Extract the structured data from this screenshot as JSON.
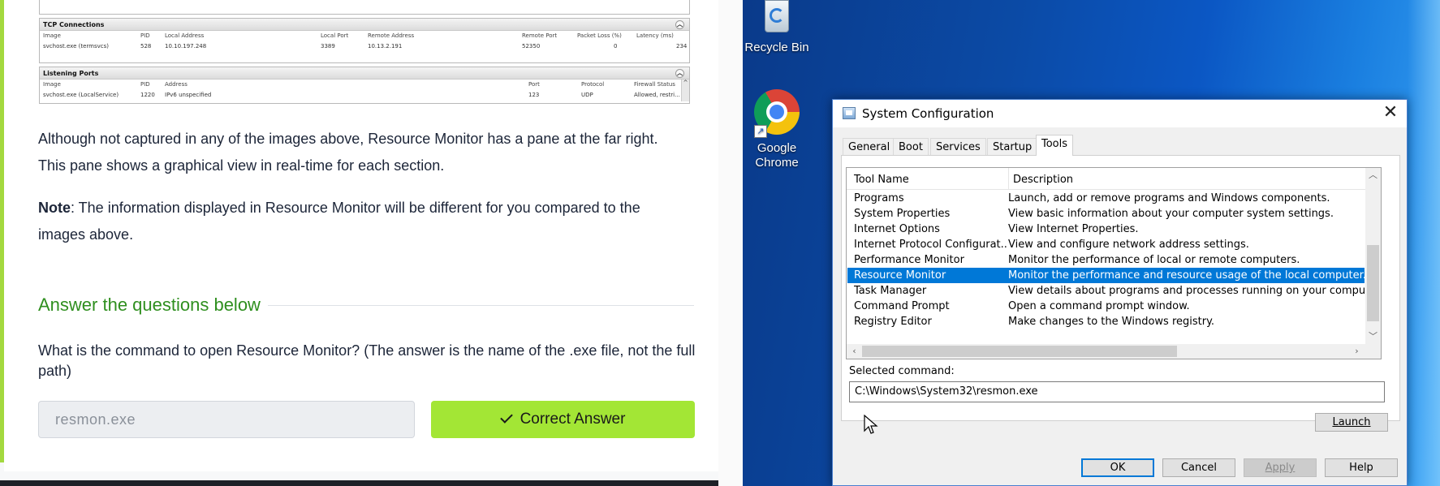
{
  "tutorial": {
    "resmon": {
      "tcp": {
        "title": "TCP Connections",
        "columns": [
          "Image",
          "PID",
          "Local Address",
          "Local Port",
          "Remote Address",
          "Remote Port",
          "Packet Loss (%)",
          "Latency (ms)"
        ],
        "row": [
          "svchost.exe (termsvcs)",
          "528",
          "10.10.197.248",
          "3389",
          "10.13.2.191",
          "52350",
          "0",
          "234"
        ]
      },
      "listening": {
        "title": "Listening Ports",
        "columns": [
          "Image",
          "PID",
          "Address",
          "Port",
          "Protocol",
          "Firewall Status"
        ],
        "row": [
          "svchost.exe (LocalService)",
          "1220",
          "IPv6 unspecified",
          "123",
          "UDP",
          "Allowed, restri..."
        ]
      }
    },
    "para1_line1": "Although not captured in any of the images above, Resource Monitor has a pane at the far right.",
    "para1_line2": "This pane shows a graphical view in real-time for each section.",
    "note_label": "Note",
    "note_line1": ": The information displayed in Resource Monitor will be different for you compared to the",
    "note_line2": "images above.",
    "answer_title": "Answer the questions below",
    "question": "What is the command to open Resource Monitor? (The answer is the name of the .exe file, not the full path)",
    "answer_value": "resmon.exe",
    "correct_label": "Correct Answer",
    "accent_color": "#a3e635",
    "title_color": "#2f8f1f"
  },
  "desktop": {
    "icons": [
      {
        "label": "Recycle Bin",
        "icon": "recycle-bin-icon"
      },
      {
        "label_line1": "Google",
        "label_line2": "Chrome",
        "icon": "chrome-icon"
      }
    ]
  },
  "dialog": {
    "title": "System Configuration",
    "tabs": [
      "General",
      "Boot",
      "Services",
      "Startup",
      "Tools"
    ],
    "active_tab": "Tools",
    "columns": [
      "Tool Name",
      "Description"
    ],
    "tools": [
      {
        "name": "Programs",
        "description": "Launch, add or remove programs and Windows components."
      },
      {
        "name": "System Properties",
        "description": "View basic information about your computer system settings."
      },
      {
        "name": "Internet Options",
        "description": "View Internet Properties."
      },
      {
        "name": "Internet Protocol Configurat...",
        "description": "View and configure network address settings."
      },
      {
        "name": "Performance Monitor",
        "description": "Monitor the performance of local or remote computers."
      },
      {
        "name": "Resource Monitor",
        "description": "Monitor the performance and resource usage of the local computer."
      },
      {
        "name": "Task Manager",
        "description": "View details about programs and processes running on your computer."
      },
      {
        "name": "Command Prompt",
        "description": "Open a command prompt window."
      },
      {
        "name": "Registry Editor",
        "description": "Make changes to the Windows registry."
      }
    ],
    "selected_tool": "Resource Monitor",
    "selected_command_label": "Selected command:",
    "selected_command": "C:\\Windows\\System32\\resmon.exe",
    "launch_label": "Launch",
    "ok_label": "OK",
    "cancel_label": "Cancel",
    "apply_label": "Apply",
    "help_label": "Help",
    "selection_color": "#0078d7"
  }
}
